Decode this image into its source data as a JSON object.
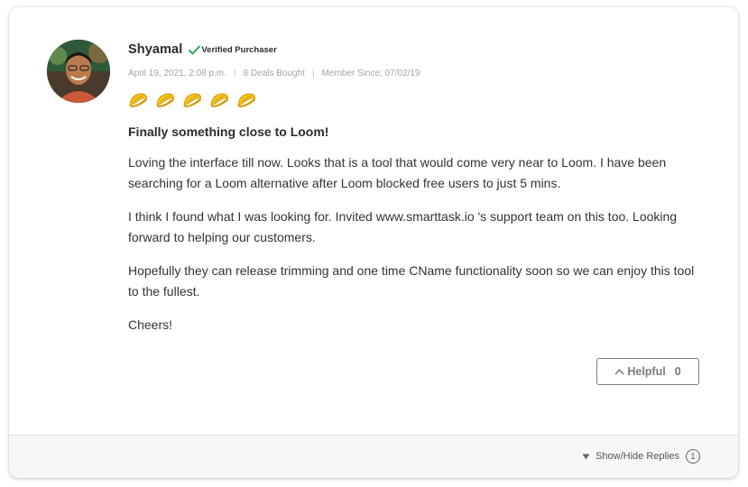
{
  "review": {
    "author": "Shyamal",
    "verified_label": "Verified Purchaser",
    "date": "April 19, 2021, 2:08 p.m.",
    "deals_bought": "8 Deals Bought",
    "member_since": "Member Since: 07/02/19",
    "separator": "|",
    "rating": 5,
    "rating_icon": "taco-icon",
    "title": "Finally something close to Loom!",
    "paragraphs": [
      "Loving the interface till now. Looks that is a tool that would come very near to Loom. I have been searching for a Loom alternative after Loom blocked free users to just 5 mins.",
      "I think I found what I was looking for. Invited www.smarttask.io 's support team on this too. Looking forward to helping our customers.",
      "Hopefully they can release trimming and one time CName functionality soon so we can enjoy this tool to the fullest.",
      "Cheers!"
    ]
  },
  "helpful": {
    "label": "Helpful",
    "count": "0",
    "icon": "chevron-up-icon"
  },
  "footer": {
    "toggle_label": "Show/Hide Replies",
    "replies_count": "1",
    "icon": "caret-down-icon"
  },
  "colors": {
    "verified_green": "#1e9e45",
    "taco_yellow": "#f6c21c",
    "taco_outline": "#d49a00",
    "muted_text": "#a3a3a3"
  }
}
